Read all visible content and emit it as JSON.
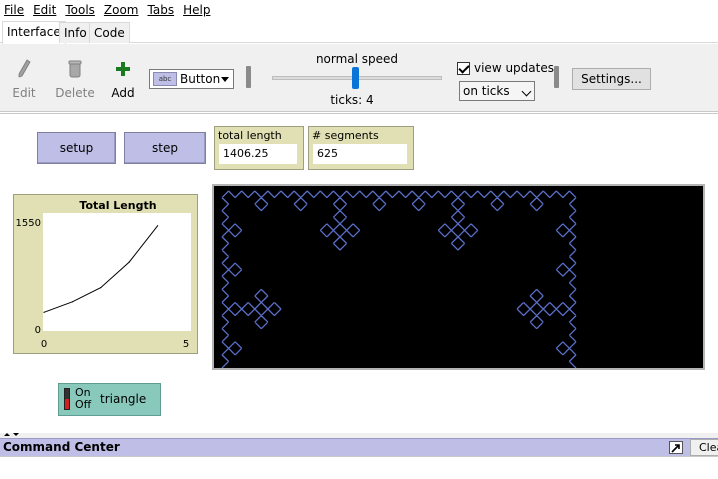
{
  "menu": [
    "File",
    "Edit",
    "Tools",
    "Zoom",
    "Tabs",
    "Help"
  ],
  "tabs": [
    "Interface",
    "Info",
    "Code"
  ],
  "toolbar": {
    "edit_label": "Edit",
    "delete_label": "Delete",
    "add_label": "Add",
    "widget_type": "Button",
    "speed_label": "normal speed",
    "speed_fraction": 0.5,
    "ticks_label": "ticks: 4",
    "view_updates_label": "view updates",
    "view_updates_checked": true,
    "update_mode": "on ticks",
    "settings_label": "Settings..."
  },
  "interface": {
    "setup_label": "setup",
    "step_label": "step",
    "monitor_length": {
      "label": "total length",
      "value": "1406.25"
    },
    "monitor_segments": {
      "label": "# segments",
      "value": "625"
    },
    "switch": {
      "on_label": "On",
      "off_label": "Off",
      "name": "triangle",
      "state": "off"
    }
  },
  "chart_data": {
    "type": "line",
    "title": "Total Length",
    "x": [
      0,
      1,
      2,
      3,
      4
    ],
    "values": [
      250,
      390,
      580,
      920,
      1406.25
    ],
    "xlim": [
      0,
      5
    ],
    "ylim": [
      0,
      1550
    ],
    "x_ticks": [
      "0",
      "5"
    ],
    "y_ticks": [
      "1550",
      "0"
    ]
  },
  "command_center": {
    "title": "Command Center",
    "clear_label": "Clear"
  },
  "colors": {
    "button_bg": "#bebee6",
    "monitor_bg": "#e0e0b4",
    "switch_bg": "#88c9bc",
    "view_bg": "#000000",
    "fractal_color": "#5a6fc8"
  }
}
